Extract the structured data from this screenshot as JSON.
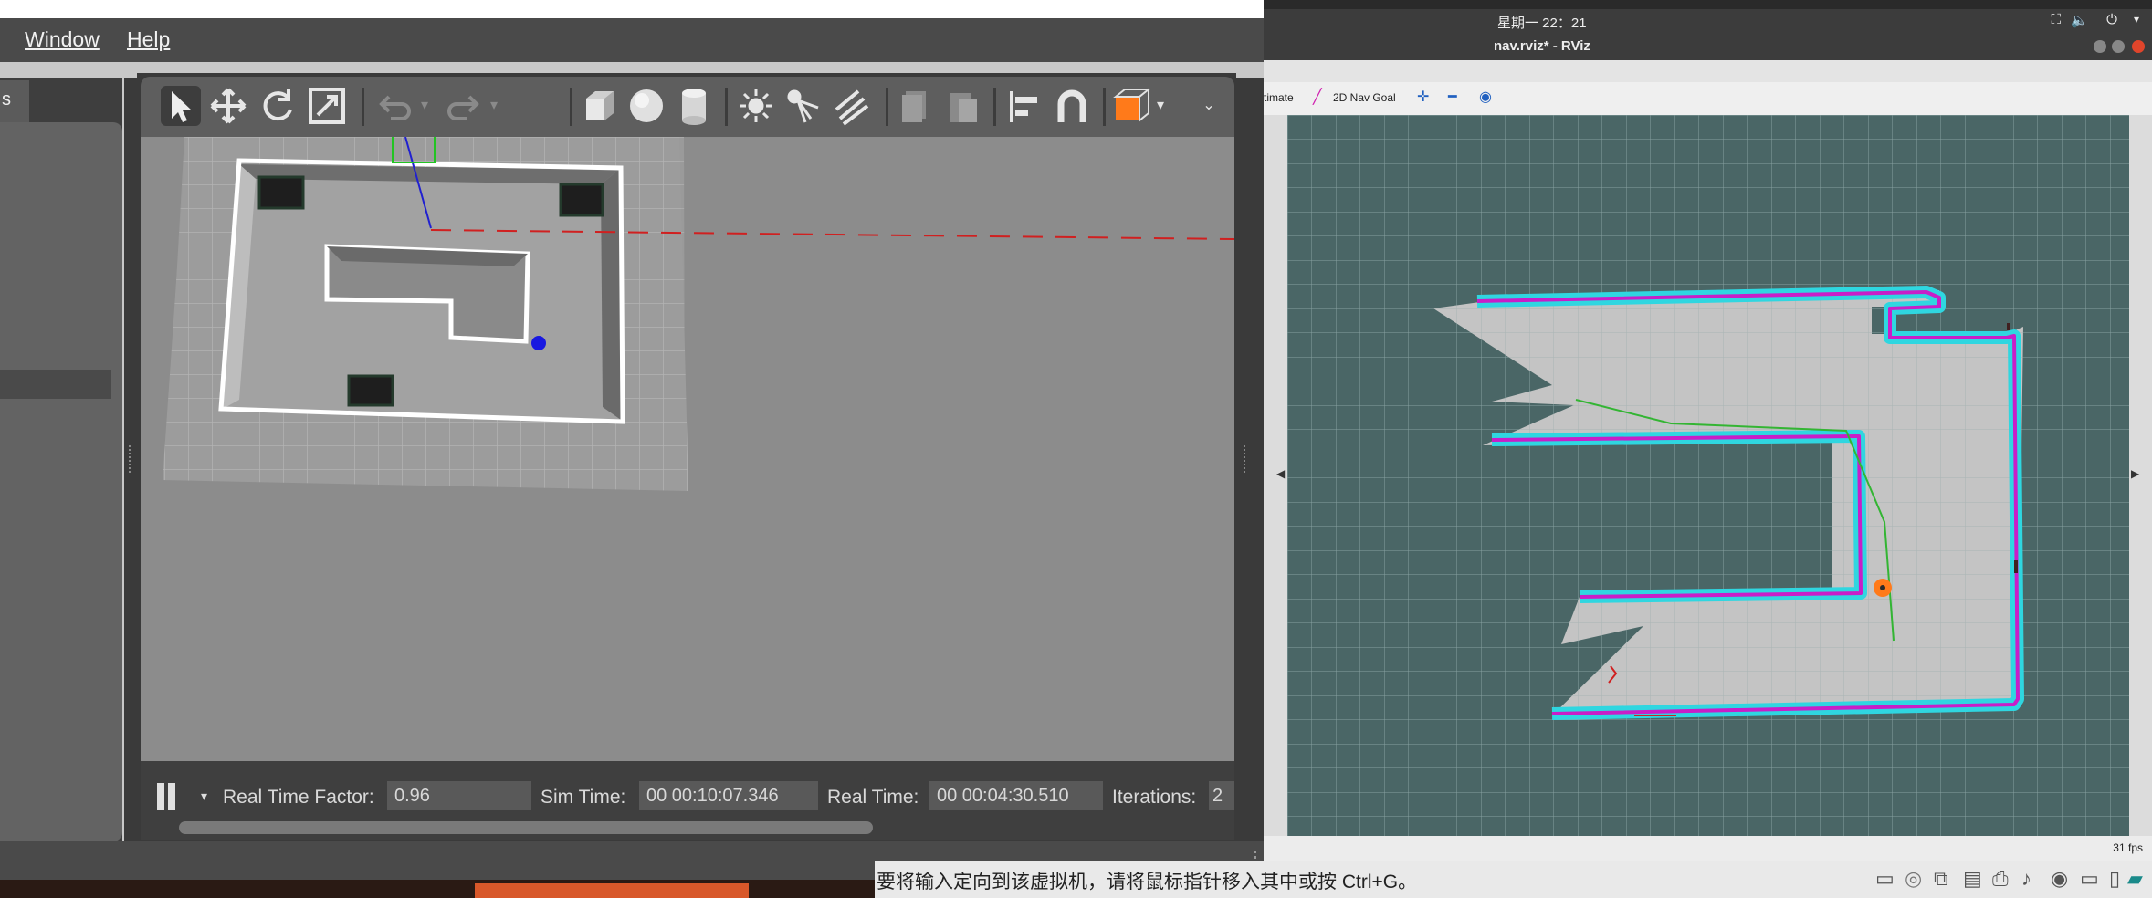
{
  "gazebo": {
    "menu": {
      "window": "Window",
      "help": "Help"
    },
    "left_tab": "s",
    "toolbar_icons": [
      "select-arrow-icon",
      "translate-icon",
      "rotate-icon",
      "scale-icon",
      "undo-icon",
      "undo-dropdown-icon",
      "redo-icon",
      "redo-dropdown-icon",
      "box-icon",
      "sphere-icon",
      "cylinder-icon",
      "point-light-icon",
      "spot-light-icon",
      "directional-light-icon",
      "copy-icon",
      "paste-icon",
      "align-icon",
      "magnet-icon",
      "view-angle-icon"
    ],
    "bottom": {
      "real_time_factor_label": "Real Time Factor:",
      "real_time_factor_value": "0.96",
      "sim_time_label": "Sim Time:",
      "sim_time_value": "00 00:10:07.346",
      "real_time_label": "Real Time:",
      "real_time_value": "00 00:04:30.510",
      "iterations_label": "Iterations:",
      "iterations_value": "2"
    }
  },
  "rviz": {
    "clock": "星期一 22：21",
    "title": "nav.rviz* - RViz",
    "toolbar": {
      "estimate_partial": "timate",
      "nav_goal": "2D Nav Goal"
    },
    "fps": "31 fps"
  },
  "hint": {
    "text": "要将输入定向到该虚拟机，请将鼠标指针移入其中或按 Ctrl+G。"
  },
  "colors": {
    "gazebo_scene": "#8f8f8f",
    "rviz_map_unknown": "#4a6666",
    "rviz_free": "#c4c4c4",
    "inflation": "#2fd6e0",
    "obstacle": "#c81ec8",
    "plan": "#33b533",
    "robot": "#ff7a1a"
  }
}
